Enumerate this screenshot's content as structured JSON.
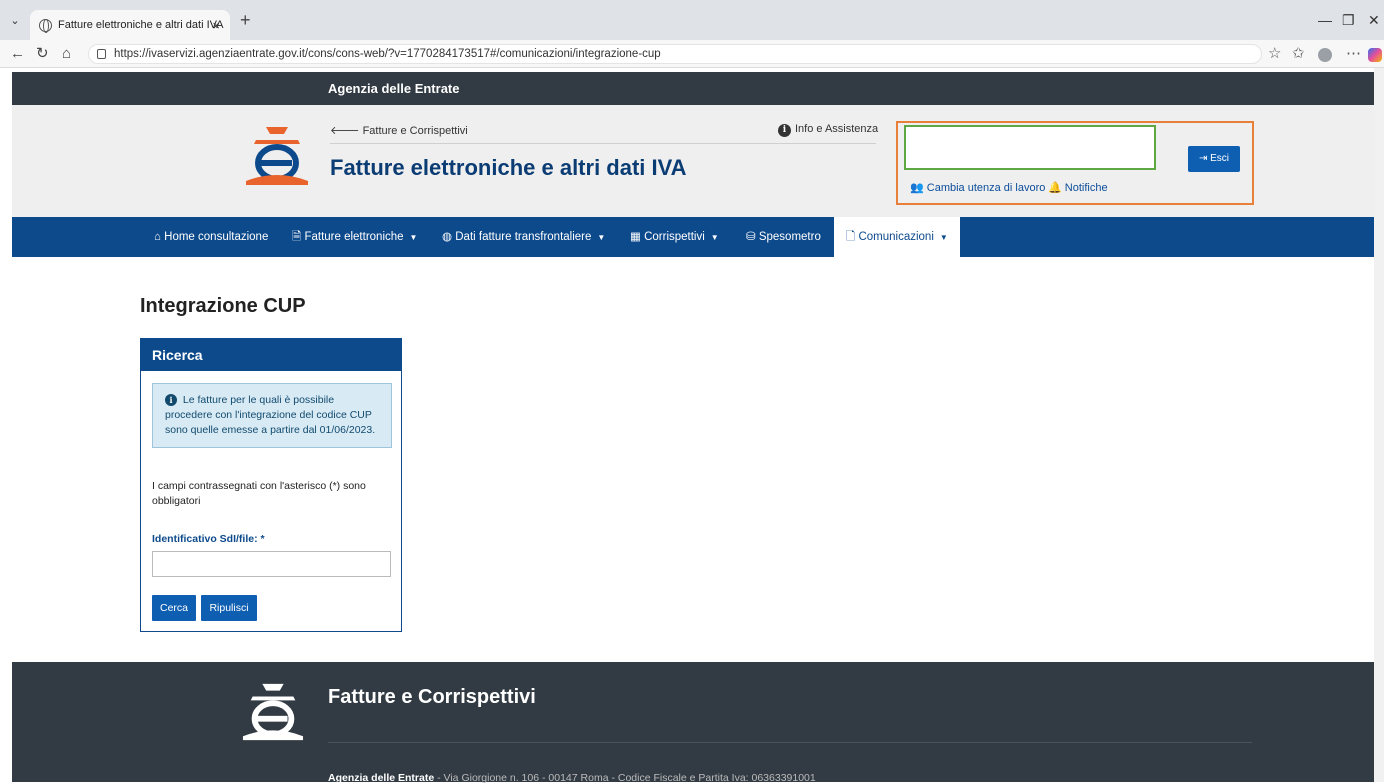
{
  "browser": {
    "tab_title": "Fatture elettroniche e altri dati IVA",
    "tab_close": "×",
    "new_tab": "+",
    "url": "https://ivaservizi.agenziaentrate.gov.it/cons/cons-web/?v=1770284173517#/comunicazioni/integrazione-cup"
  },
  "site": {
    "brand": "Agenzia delle Entrate",
    "back_link": "Fatture e Corrispettivi",
    "info_link": "Info e Assistenza",
    "app_title": "Fatture elettroniche e altri dati IVA"
  },
  "user": {
    "esci_label": "Esci",
    "cambia_label": "Cambia utenza di lavoro",
    "notifiche_label": "Notifiche"
  },
  "nav": {
    "home": "Home consultazione",
    "fatture": "Fatture elettroniche",
    "dati": "Dati fatture transfrontaliere",
    "corrispettivi": "Corrispettivi",
    "spesometro": "Spesometro",
    "comunicazioni": "Comunicazioni"
  },
  "page": {
    "title": "Integrazione CUP",
    "panel_title": "Ricerca",
    "alert_text": "Le fatture per le quali è possibile procedere con l'integrazione del codice CUP sono quelle emesse a partire dal 01/06/2023.",
    "required_note": "I campi contrassegnati con l'asterisco (*) sono obbligatori",
    "field_label": "Identificativo SdI/file: *",
    "field_value": "",
    "search_button": "Cerca",
    "clear_button": "Ripulisci"
  },
  "footer": {
    "title": "Fatture e Corrispettivi",
    "org": "Agenzia delle Entrate",
    "address": " - Via Giorgione n. 106 - 00147 Roma - Codice Fiscale e Partita Iva: 06363391001"
  },
  "colors": {
    "nav_blue": "#0d4a8c",
    "button_blue": "#0e5eb2",
    "dark_bar": "#323b43",
    "highlight_orange": "#e8803a",
    "highlight_green": "#5da843"
  }
}
